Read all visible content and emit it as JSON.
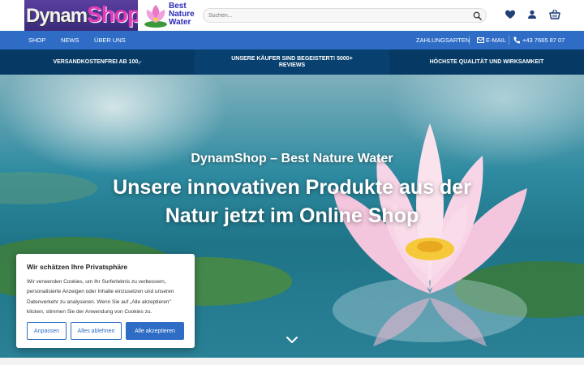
{
  "logo": {
    "part1": "Dynam",
    "part2": "Shop",
    "sub": "Best Nature Water"
  },
  "search": {
    "placeholder": "Suchen..."
  },
  "header_icons": [
    "heart-icon",
    "user-icon",
    "basket-icon"
  ],
  "nav": {
    "left": [
      "SHOP",
      "NEWS",
      "ÜBER UNS"
    ],
    "payment": "ZAHLUNGSARTEN",
    "email": "E-MAIL",
    "phone": "+43 7665 87 07"
  },
  "info": [
    "VERSANDKOSTENFREI AB 100,-",
    "UNSERE KÄUFER SIND BEGEISTERT! 5000+ REVIEWS",
    "HÖCHSTE QUALITÄT UND WIRKSAMKEIT"
  ],
  "hero": {
    "subtitle": "DynamShop – Best Nature Water",
    "title": "Unsere innovativen Produkte aus der Natur jetzt im Online Shop"
  },
  "cookie": {
    "title": "Wir schätzen Ihre Privatsphäre",
    "text": "Wir verwenden Cookies, um Ihr Surferlebnis zu verbessern, personalisierte Anzeigen oder Inhalte einzusetzen und unseren Datenverkehr zu analysieren. Wenn Sie auf „Alle akzeptieren\" klicken, stimmen Sie der Anwendung von Cookies zu.",
    "buttons": {
      "customize": "Anpassen",
      "reject": "Alles ablehnen",
      "accept": "Alle akzeptieren"
    }
  },
  "colors": {
    "nav_blue": "#2e6cc6",
    "info_navy": "#063a64",
    "brand_pink": "#e13cb8"
  }
}
